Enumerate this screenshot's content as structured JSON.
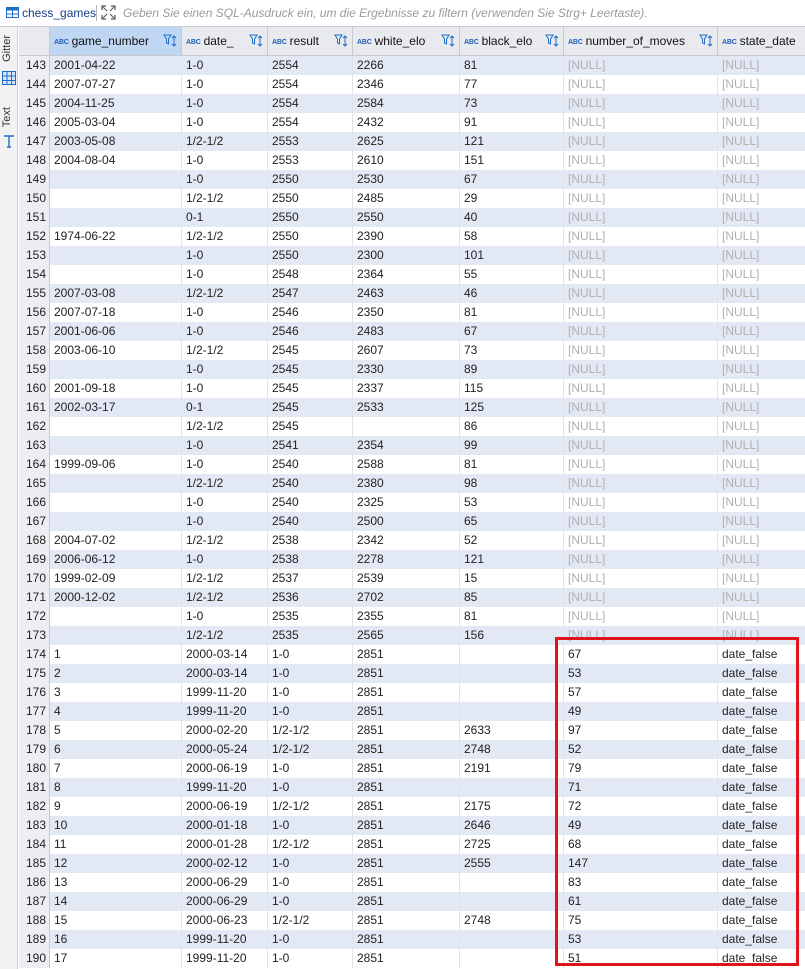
{
  "tab": {
    "title": "chess_games",
    "icon": "table-icon"
  },
  "filter": {
    "placeholder": "Geben Sie einen SQL-Ausdruck ein, um die Ergebnisse zu filtern (verwenden Sie Strg+ Leertaste)."
  },
  "side_tabs": [
    {
      "label": "Gitter",
      "icon": "grid-icon"
    },
    {
      "label": "Text",
      "icon": "text-icon"
    }
  ],
  "columns": [
    {
      "label": "game_number",
      "type_badge": "ABC"
    },
    {
      "label": "date_",
      "type_badge": "ABC"
    },
    {
      "label": "result",
      "type_badge": "ABC"
    },
    {
      "label": "white_elo",
      "type_badge": "ABC"
    },
    {
      "label": "black_elo",
      "type_badge": "ABC"
    },
    {
      "label": "number_of_moves",
      "type_badge": "ABC"
    },
    {
      "label": "state_date",
      "type_badge": "ABC"
    }
  ],
  "rows": [
    [
      "143",
      "2001-04-22",
      "1-0",
      "2554",
      "2266",
      "81",
      "[NULL]",
      "[NULL]"
    ],
    [
      "144",
      "2007-07-27",
      "1-0",
      "2554",
      "2346",
      "77",
      "[NULL]",
      "[NULL]"
    ],
    [
      "145",
      "2004-11-25",
      "1-0",
      "2554",
      "2584",
      "73",
      "[NULL]",
      "[NULL]"
    ],
    [
      "146",
      "2005-03-04",
      "1-0",
      "2554",
      "2432",
      "91",
      "[NULL]",
      "[NULL]"
    ],
    [
      "147",
      "2003-05-08",
      "1/2-1/2",
      "2553",
      "2625",
      "121",
      "[NULL]",
      "[NULL]"
    ],
    [
      "148",
      "2004-08-04",
      "1-0",
      "2553",
      "2610",
      "151",
      "[NULL]",
      "[NULL]"
    ],
    [
      "149",
      "",
      "1-0",
      "2550",
      "2530",
      "67",
      "[NULL]",
      "[NULL]"
    ],
    [
      "150",
      "",
      "1/2-1/2",
      "2550",
      "2485",
      "29",
      "[NULL]",
      "[NULL]"
    ],
    [
      "151",
      "",
      "0-1",
      "2550",
      "2550",
      "40",
      "[NULL]",
      "[NULL]"
    ],
    [
      "152",
      "1974-06-22",
      "1/2-1/2",
      "2550",
      "2390",
      "58",
      "[NULL]",
      "[NULL]"
    ],
    [
      "153",
      "",
      "1-0",
      "2550",
      "2300",
      "101",
      "[NULL]",
      "[NULL]"
    ],
    [
      "154",
      "",
      "1-0",
      "2548",
      "2364",
      "55",
      "[NULL]",
      "[NULL]"
    ],
    [
      "155",
      "2007-03-08",
      "1/2-1/2",
      "2547",
      "2463",
      "46",
      "[NULL]",
      "[NULL]"
    ],
    [
      "156",
      "2007-07-18",
      "1-0",
      "2546",
      "2350",
      "81",
      "[NULL]",
      "[NULL]"
    ],
    [
      "157",
      "2001-06-06",
      "1-0",
      "2546",
      "2483",
      "67",
      "[NULL]",
      "[NULL]"
    ],
    [
      "158",
      "2003-06-10",
      "1/2-1/2",
      "2545",
      "2607",
      "73",
      "[NULL]",
      "[NULL]"
    ],
    [
      "159",
      "",
      "1-0",
      "2545",
      "2330",
      "89",
      "[NULL]",
      "[NULL]"
    ],
    [
      "160",
      "2001-09-18",
      "1-0",
      "2545",
      "2337",
      "115",
      "[NULL]",
      "[NULL]"
    ],
    [
      "161",
      "2002-03-17",
      "0-1",
      "2545",
      "2533",
      "125",
      "[NULL]",
      "[NULL]"
    ],
    [
      "162",
      "",
      "1/2-1/2",
      "2545",
      "",
      "86",
      "[NULL]",
      "[NULL]"
    ],
    [
      "163",
      "",
      "1-0",
      "2541",
      "2354",
      "99",
      "[NULL]",
      "[NULL]"
    ],
    [
      "164",
      "1999-09-06",
      "1-0",
      "2540",
      "2588",
      "81",
      "[NULL]",
      "[NULL]"
    ],
    [
      "165",
      "",
      "1/2-1/2",
      "2540",
      "2380",
      "98",
      "[NULL]",
      "[NULL]"
    ],
    [
      "166",
      "",
      "1-0",
      "2540",
      "2325",
      "53",
      "[NULL]",
      "[NULL]"
    ],
    [
      "167",
      "",
      "1-0",
      "2540",
      "2500",
      "65",
      "[NULL]",
      "[NULL]"
    ],
    [
      "168",
      "2004-07-02",
      "1/2-1/2",
      "2538",
      "2342",
      "52",
      "[NULL]",
      "[NULL]"
    ],
    [
      "169",
      "2006-06-12",
      "1-0",
      "2538",
      "2278",
      "121",
      "[NULL]",
      "[NULL]"
    ],
    [
      "170",
      "1999-02-09",
      "1/2-1/2",
      "2537",
      "2539",
      "15",
      "[NULL]",
      "[NULL]"
    ],
    [
      "171",
      "2000-12-02",
      "1/2-1/2",
      "2536",
      "2702",
      "85",
      "[NULL]",
      "[NULL]"
    ],
    [
      "172",
      "",
      "1-0",
      "2535",
      "2355",
      "81",
      "[NULL]",
      "[NULL]"
    ],
    [
      "173",
      "",
      "1/2-1/2",
      "2535",
      "2565",
      "156",
      "[NULL]",
      "[NULL]"
    ],
    [
      "174",
      "1",
      "2000-03-14",
      "1-0",
      "2851",
      "",
      "67",
      "date_false"
    ],
    [
      "175",
      "2",
      "2000-03-14",
      "1-0",
      "2851",
      "",
      "53",
      "date_false"
    ],
    [
      "176",
      "3",
      "1999-11-20",
      "1-0",
      "2851",
      "",
      "57",
      "date_false"
    ],
    [
      "177",
      "4",
      "1999-11-20",
      "1-0",
      "2851",
      "",
      "49",
      "date_false"
    ],
    [
      "178",
      "5",
      "2000-02-20",
      "1/2-1/2",
      "2851",
      "2633",
      "97",
      "date_false"
    ],
    [
      "179",
      "6",
      "2000-05-24",
      "1/2-1/2",
      "2851",
      "2748",
      "52",
      "date_false"
    ],
    [
      "180",
      "7",
      "2000-06-19",
      "1-0",
      "2851",
      "2191",
      "79",
      "date_false"
    ],
    [
      "181",
      "8",
      "1999-11-20",
      "1-0",
      "2851",
      "",
      "71",
      "date_false"
    ],
    [
      "182",
      "9",
      "2000-06-19",
      "1/2-1/2",
      "2851",
      "2175",
      "72",
      "date_false"
    ],
    [
      "183",
      "10",
      "2000-01-18",
      "1-0",
      "2851",
      "2646",
      "49",
      "date_false"
    ],
    [
      "184",
      "11",
      "2000-01-28",
      "1/2-1/2",
      "2851",
      "2725",
      "68",
      "date_false"
    ],
    [
      "185",
      "12",
      "2000-02-12",
      "1-0",
      "2851",
      "2555",
      "147",
      "date_false"
    ],
    [
      "186",
      "13",
      "2000-06-29",
      "1-0",
      "2851",
      "",
      "83",
      "date_false"
    ],
    [
      "187",
      "14",
      "2000-06-29",
      "1-0",
      "2851",
      "",
      "61",
      "date_false"
    ],
    [
      "188",
      "15",
      "2000-06-23",
      "1/2-1/2",
      "2851",
      "2748",
      "75",
      "date_false"
    ],
    [
      "189",
      "16",
      "1999-11-20",
      "1-0",
      "2851",
      "",
      "53",
      "date_false"
    ],
    [
      "190",
      "17",
      "1999-11-20",
      "1-0",
      "2851",
      "",
      "51",
      "date_false"
    ]
  ],
  "colors": {
    "row_stripe": "#e2e9f5",
    "header": "#e8eaed",
    "active_header": "#bfd7f3",
    "highlight": "#e0141c",
    "null_text": "#b0b0b0"
  }
}
